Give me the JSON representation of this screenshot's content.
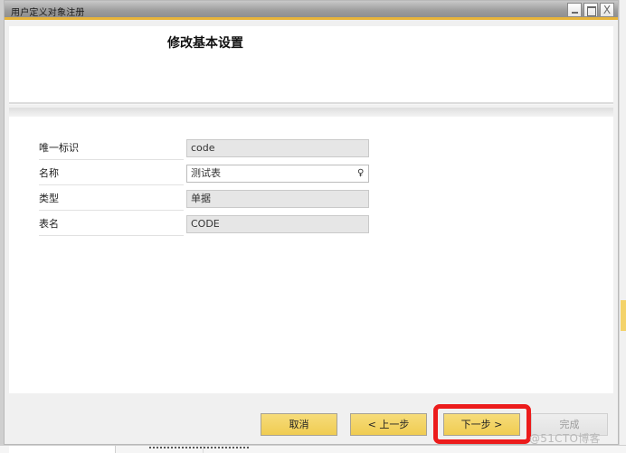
{
  "window": {
    "title": "用户定义对象注册",
    "controls": {
      "minimize_icon": "minimize-icon",
      "maximize_icon": "maximize-icon",
      "close_glyph": "X"
    }
  },
  "header": {
    "heading": "修改基本设置"
  },
  "form": {
    "fields": [
      {
        "label": "唯一标识",
        "value": "code",
        "editable": false
      },
      {
        "label": "名称",
        "value": "测试表",
        "editable": true,
        "icon": "pin-icon"
      },
      {
        "label": "类型",
        "value": "单据",
        "editable": false
      },
      {
        "label": "表名",
        "value": "CODE",
        "editable": false
      }
    ]
  },
  "footer": {
    "buttons": {
      "cancel": "取消",
      "back": "< 上一步",
      "next": "下一步 >",
      "finish": "完成"
    },
    "highlighted": "next"
  },
  "colors": {
    "accent": "#e7b43a",
    "button_yellow": "#f0cc52",
    "highlight_red": "#ec1c1c"
  },
  "watermark": "@51CTO博客"
}
